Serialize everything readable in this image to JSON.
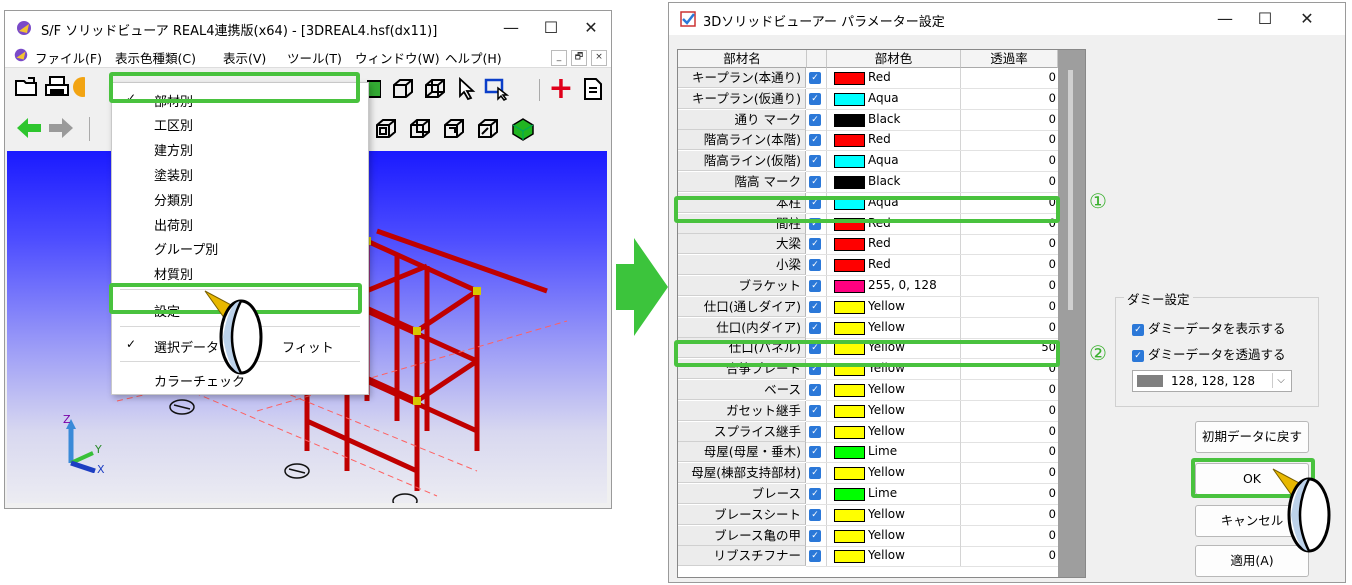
{
  "left_window": {
    "title": "S/F ソリッドビューア REAL4連携版(x64) - [3DREAL4.hsf(dx11)]",
    "controls": {
      "minimize": "—",
      "maximize": "☐",
      "close": "✕"
    },
    "menu": [
      "ファイル(F)",
      "表示色種類(C)",
      "表示(V)",
      "ツール(T)",
      "ウィンドウ(W)",
      "ヘルプ(H)"
    ],
    "mdi_controls": {
      "minimize": "_",
      "restore": "🗗",
      "close": "×"
    },
    "dropdown": {
      "items": [
        {
          "label": "部材別",
          "checked": true
        },
        {
          "label": "工区別",
          "checked": false
        },
        {
          "label": "建方別",
          "checked": false
        },
        {
          "label": "塗装別",
          "checked": false
        },
        {
          "label": "分類別",
          "checked": false
        },
        {
          "label": "出荷別",
          "checked": false
        },
        {
          "label": "グループ別",
          "checked": false
        },
        {
          "label": "材質別",
          "checked": false
        }
      ],
      "settings_label": "設定",
      "select_label": "選択データ",
      "select_label_tail": "フィット",
      "select_checked": true,
      "color_check_label": "カラーチェック"
    },
    "axes": {
      "z": "Z",
      "y": "Y",
      "x": "X"
    }
  },
  "dialog": {
    "title": "3Dソリッドビューアー パラメーター設定",
    "controls": {
      "minimize": "—",
      "maximize": "☐",
      "close": "✕"
    },
    "columns": [
      "部材名",
      "部材色",
      "透過率"
    ],
    "rows": [
      {
        "name": "キープラン(本通り)",
        "color_name": "Red",
        "color": "#ff0000",
        "transparency": "0"
      },
      {
        "name": "キープラン(仮通り)",
        "color_name": "Aqua",
        "color": "#00ffff",
        "transparency": "0"
      },
      {
        "name": "通り マーク",
        "color_name": "Black",
        "color": "#000000",
        "transparency": "0"
      },
      {
        "name": "階高ライン(本階)",
        "color_name": "Red",
        "color": "#ff0000",
        "transparency": "0"
      },
      {
        "name": "階高ライン(仮階)",
        "color_name": "Aqua",
        "color": "#00ffff",
        "transparency": "0"
      },
      {
        "name": "階高 マーク",
        "color_name": "Black",
        "color": "#000000",
        "transparency": "0"
      },
      {
        "name": "本柱",
        "color_name": "Aqua",
        "color": "#00ffff",
        "transparency": "0"
      },
      {
        "name": "間柱",
        "color_name": "Red",
        "color": "#ff0000",
        "transparency": "0"
      },
      {
        "name": "大梁",
        "color_name": "Red",
        "color": "#ff0000",
        "transparency": "0"
      },
      {
        "name": "小梁",
        "color_name": "Red",
        "color": "#ff0000",
        "transparency": "0"
      },
      {
        "name": "ブラケット",
        "color_name": "255, 0, 128",
        "color": "#ff0080",
        "transparency": "0"
      },
      {
        "name": "仕口(通しダイア)",
        "color_name": "Yellow",
        "color": "#ffff00",
        "transparency": "0"
      },
      {
        "name": "仕口(内ダイア)",
        "color_name": "Yellow",
        "color": "#ffff00",
        "transparency": "0"
      },
      {
        "name": "仕口(パネル)",
        "color_name": "Yellow",
        "color": "#ffff00",
        "transparency": "50"
      },
      {
        "name": "合筝プレート",
        "color_name": "Yellow",
        "color": "#ffff00",
        "transparency": "0"
      },
      {
        "name": "ベース",
        "color_name": "Yellow",
        "color": "#ffff00",
        "transparency": "0"
      },
      {
        "name": "ガセット継手",
        "color_name": "Yellow",
        "color": "#ffff00",
        "transparency": "0"
      },
      {
        "name": "スプライス継手",
        "color_name": "Yellow",
        "color": "#ffff00",
        "transparency": "0"
      },
      {
        "name": "母屋(母屋・垂木)",
        "color_name": "Lime",
        "color": "#00ff00",
        "transparency": "0"
      },
      {
        "name": "母屋(棟部支持部材)",
        "color_name": "Yellow",
        "color": "#ffff00",
        "transparency": "0"
      },
      {
        "name": "ブレース",
        "color_name": "Lime",
        "color": "#00ff00",
        "transparency": "0"
      },
      {
        "name": "ブレースシート",
        "color_name": "Yellow",
        "color": "#ffff00",
        "transparency": "0"
      },
      {
        "name": "ブレース亀の甲",
        "color_name": "Yellow",
        "color": "#ffff00",
        "transparency": "0"
      },
      {
        "name": "リブスチフナー",
        "color_name": "Yellow",
        "color": "#ffff00",
        "transparency": "0"
      }
    ],
    "markers": {
      "one": "①",
      "two": "②"
    },
    "dummy": {
      "legend": "ダミー設定",
      "show_label": "ダミーデータを表示する",
      "transparent_label": "ダミーデータを透過する",
      "color_value": "128, 128, 128"
    },
    "buttons": {
      "reset": "初期データに戻す",
      "ok": "OK",
      "cancel": "キャンセル",
      "apply": "適用(A)"
    }
  }
}
